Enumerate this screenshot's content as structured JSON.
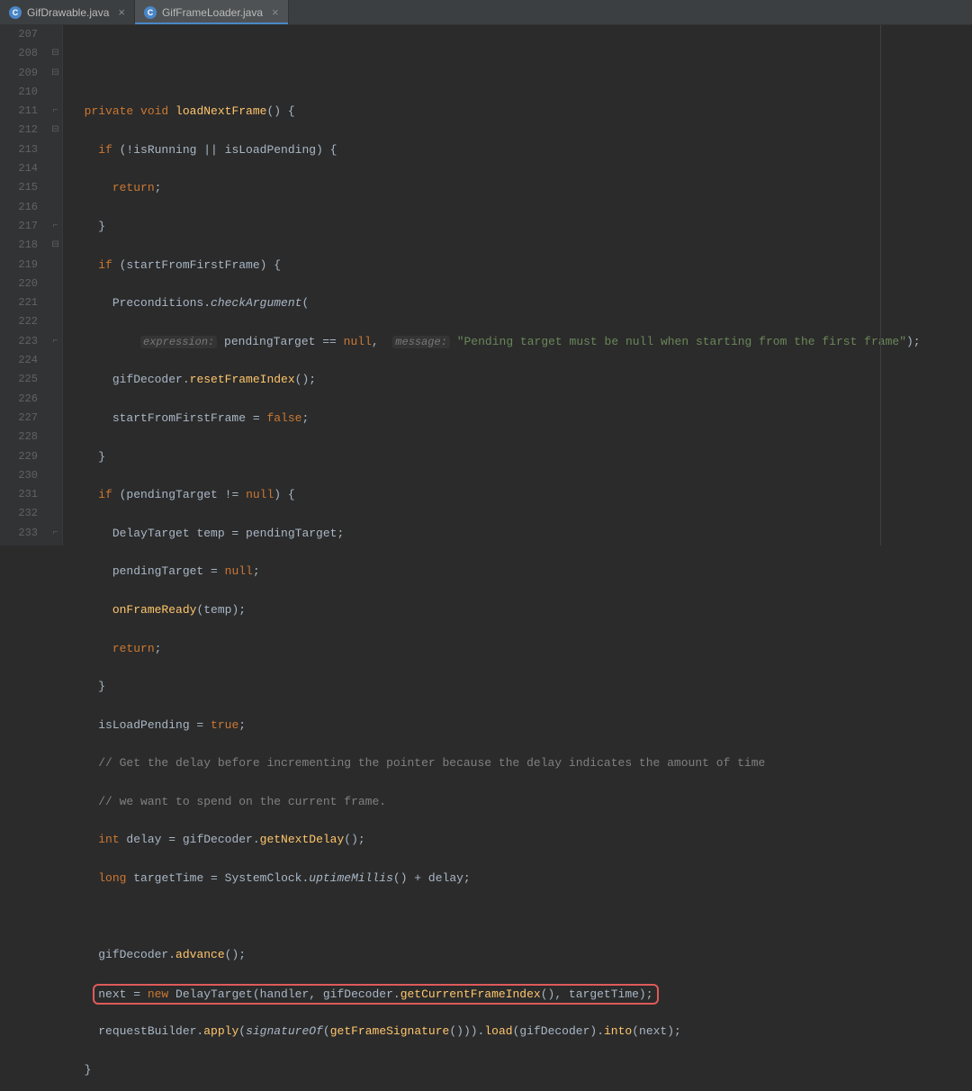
{
  "tabs": [
    {
      "icon": "C",
      "label": "GifDrawable.java",
      "active": false
    },
    {
      "icon": "C",
      "label": "GifFrameLoader.java",
      "active": true
    }
  ],
  "gutter": {
    "start": 207,
    "end": 233
  },
  "code": {
    "l208_kw1": "private void",
    "l208_name": " loadNextFrame",
    "l208_rest": "() {",
    "l209": "if",
    "l209_rest": " (!isRunning || isLoadPending) {",
    "l210": "return",
    "l210_semi": ";",
    "l211": "}",
    "l212_if": "if",
    "l212_rest": " (startFromFirstFrame) {",
    "l213_a": "Preconditions.",
    "l213_b": "checkArgument",
    "l213_c": "(",
    "l214_hint1": "expression:",
    "l214_mid": " pendingTarget == ",
    "l214_null": "null",
    "l214_comma": ",  ",
    "l214_hint2": "message:",
    "l214_str": " \"Pending target must be null when starting from the first frame\"",
    "l214_end": ");",
    "l215_a": "gifDecoder.",
    "l215_b": "resetFrameIndex",
    "l215_c": "();",
    "l216_a": "startFromFirstFrame = ",
    "l216_b": "false",
    "l216_c": ";",
    "l217": "}",
    "l218_if": "if",
    "l218_rest": " (pendingTarget != ",
    "l218_null": "null",
    "l218_end": ") {",
    "l219": "DelayTarget temp = pendingTarget;",
    "l220_a": "pendingTarget = ",
    "l220_b": "null",
    "l220_c": ";",
    "l221_a": "onFrameReady",
    "l221_b": "(temp);",
    "l222_a": "return",
    "l222_b": ";",
    "l223": "}",
    "l224_a": "isLoadPending = ",
    "l224_b": "true",
    "l224_c": ";",
    "l225": "// Get the delay before incrementing the pointer because the delay indicates the amount of time",
    "l226": "// we want to spend on the current frame.",
    "l227_a": "int",
    "l227_b": " delay = gifDecoder.",
    "l227_c": "getNextDelay",
    "l227_d": "();",
    "l228_a": "long",
    "l228_b": " targetTime = SystemClock.",
    "l228_c": "uptimeMillis",
    "l228_d": "() + delay;",
    "l230_a": "gifDecoder.",
    "l230_b": "advance",
    "l230_c": "();",
    "l231_a": "next = ",
    "l231_b": "new",
    "l231_c": " DelayTarget(handler, gifDecoder.",
    "l231_d": "getCurrentFrameIndex",
    "l231_e": "(), targetTime);",
    "l232_a": "requestBuilder.",
    "l232_b": "apply",
    "l232_c": "(",
    "l232_d": "signatureOf",
    "l232_e": "(",
    "l232_f": "getFrameSignature",
    "l232_g": "())).",
    "l232_h": "load",
    "l232_i": "(gifDecoder).",
    "l232_j": "into",
    "l232_k": "(next);",
    "l233": "}"
  }
}
